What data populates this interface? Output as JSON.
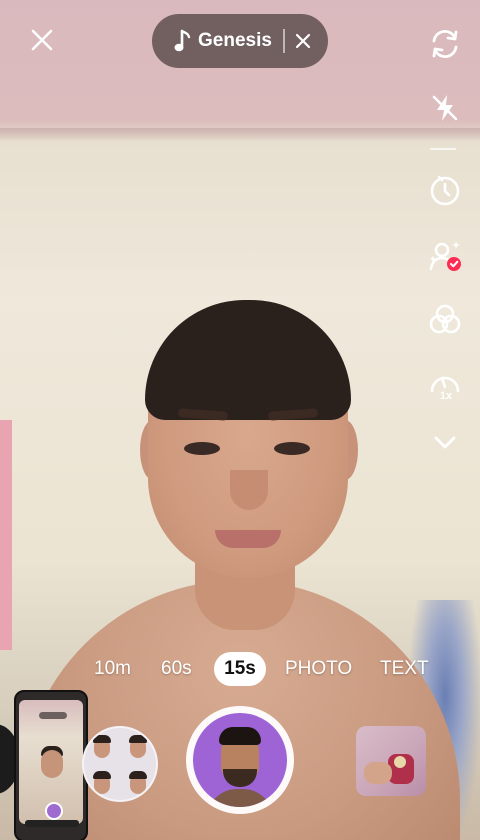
{
  "top_bar": {
    "close_icon": "close-icon",
    "sound": {
      "icon": "music-note-icon",
      "title": "Genesis",
      "remove_icon": "close-icon"
    }
  },
  "right_toolbar": {
    "items": [
      {
        "icon": "flip-camera-icon"
      },
      {
        "icon": "flash-off-icon"
      },
      {
        "icon": "timer-icon"
      },
      {
        "icon": "retouch-icon"
      },
      {
        "icon": "filters-icon"
      },
      {
        "icon": "speed-icon",
        "label": "1x"
      },
      {
        "icon": "chevron-down-icon"
      }
    ],
    "accent_color": "#fe2c55"
  },
  "modes": {
    "items": [
      "10m",
      "60s",
      "15s",
      "PHOTO",
      "TEXT"
    ],
    "selected": "15s"
  },
  "bottom": {
    "record_button_color": "#9e64d6"
  }
}
